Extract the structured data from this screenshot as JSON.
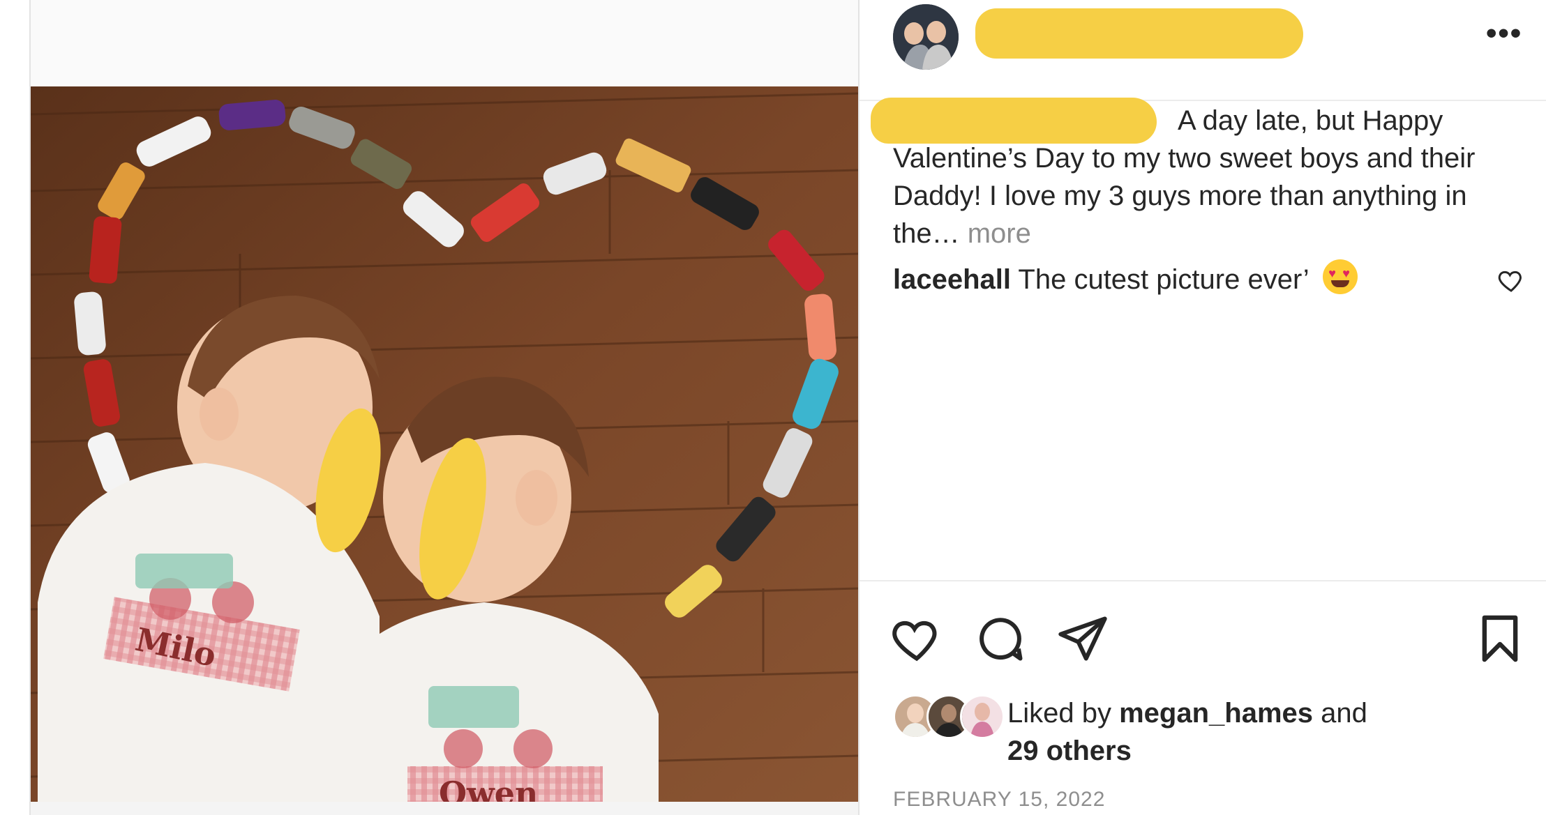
{
  "post": {
    "author_avatar_alt": "profile-photo",
    "caption": "A day late, but Happy Valentine’s Day to my two sweet boys and their Daddy! I love my 3 guys more than anything in the…",
    "caption_more": "more",
    "comment": {
      "username": "laceehall",
      "text": "The cutest picture ever’"
    },
    "likes": {
      "prefix": "Liked by",
      "user": "megan_hames",
      "connector": "and",
      "others": "29 others"
    },
    "date": "FEBRUARY 15, 2022"
  },
  "photo": {
    "shirt_name_left": "Milo",
    "shirt_name_right": "Owen"
  },
  "icons": {
    "menu": "more-options-icon",
    "like": "heart-icon",
    "comment": "comment-icon",
    "share": "send-icon",
    "save": "bookmark-icon"
  },
  "colors": {
    "redaction": "#f6cf45",
    "text": "#262626",
    "muted": "#8e8e8e",
    "floor": "#6b3d22"
  }
}
